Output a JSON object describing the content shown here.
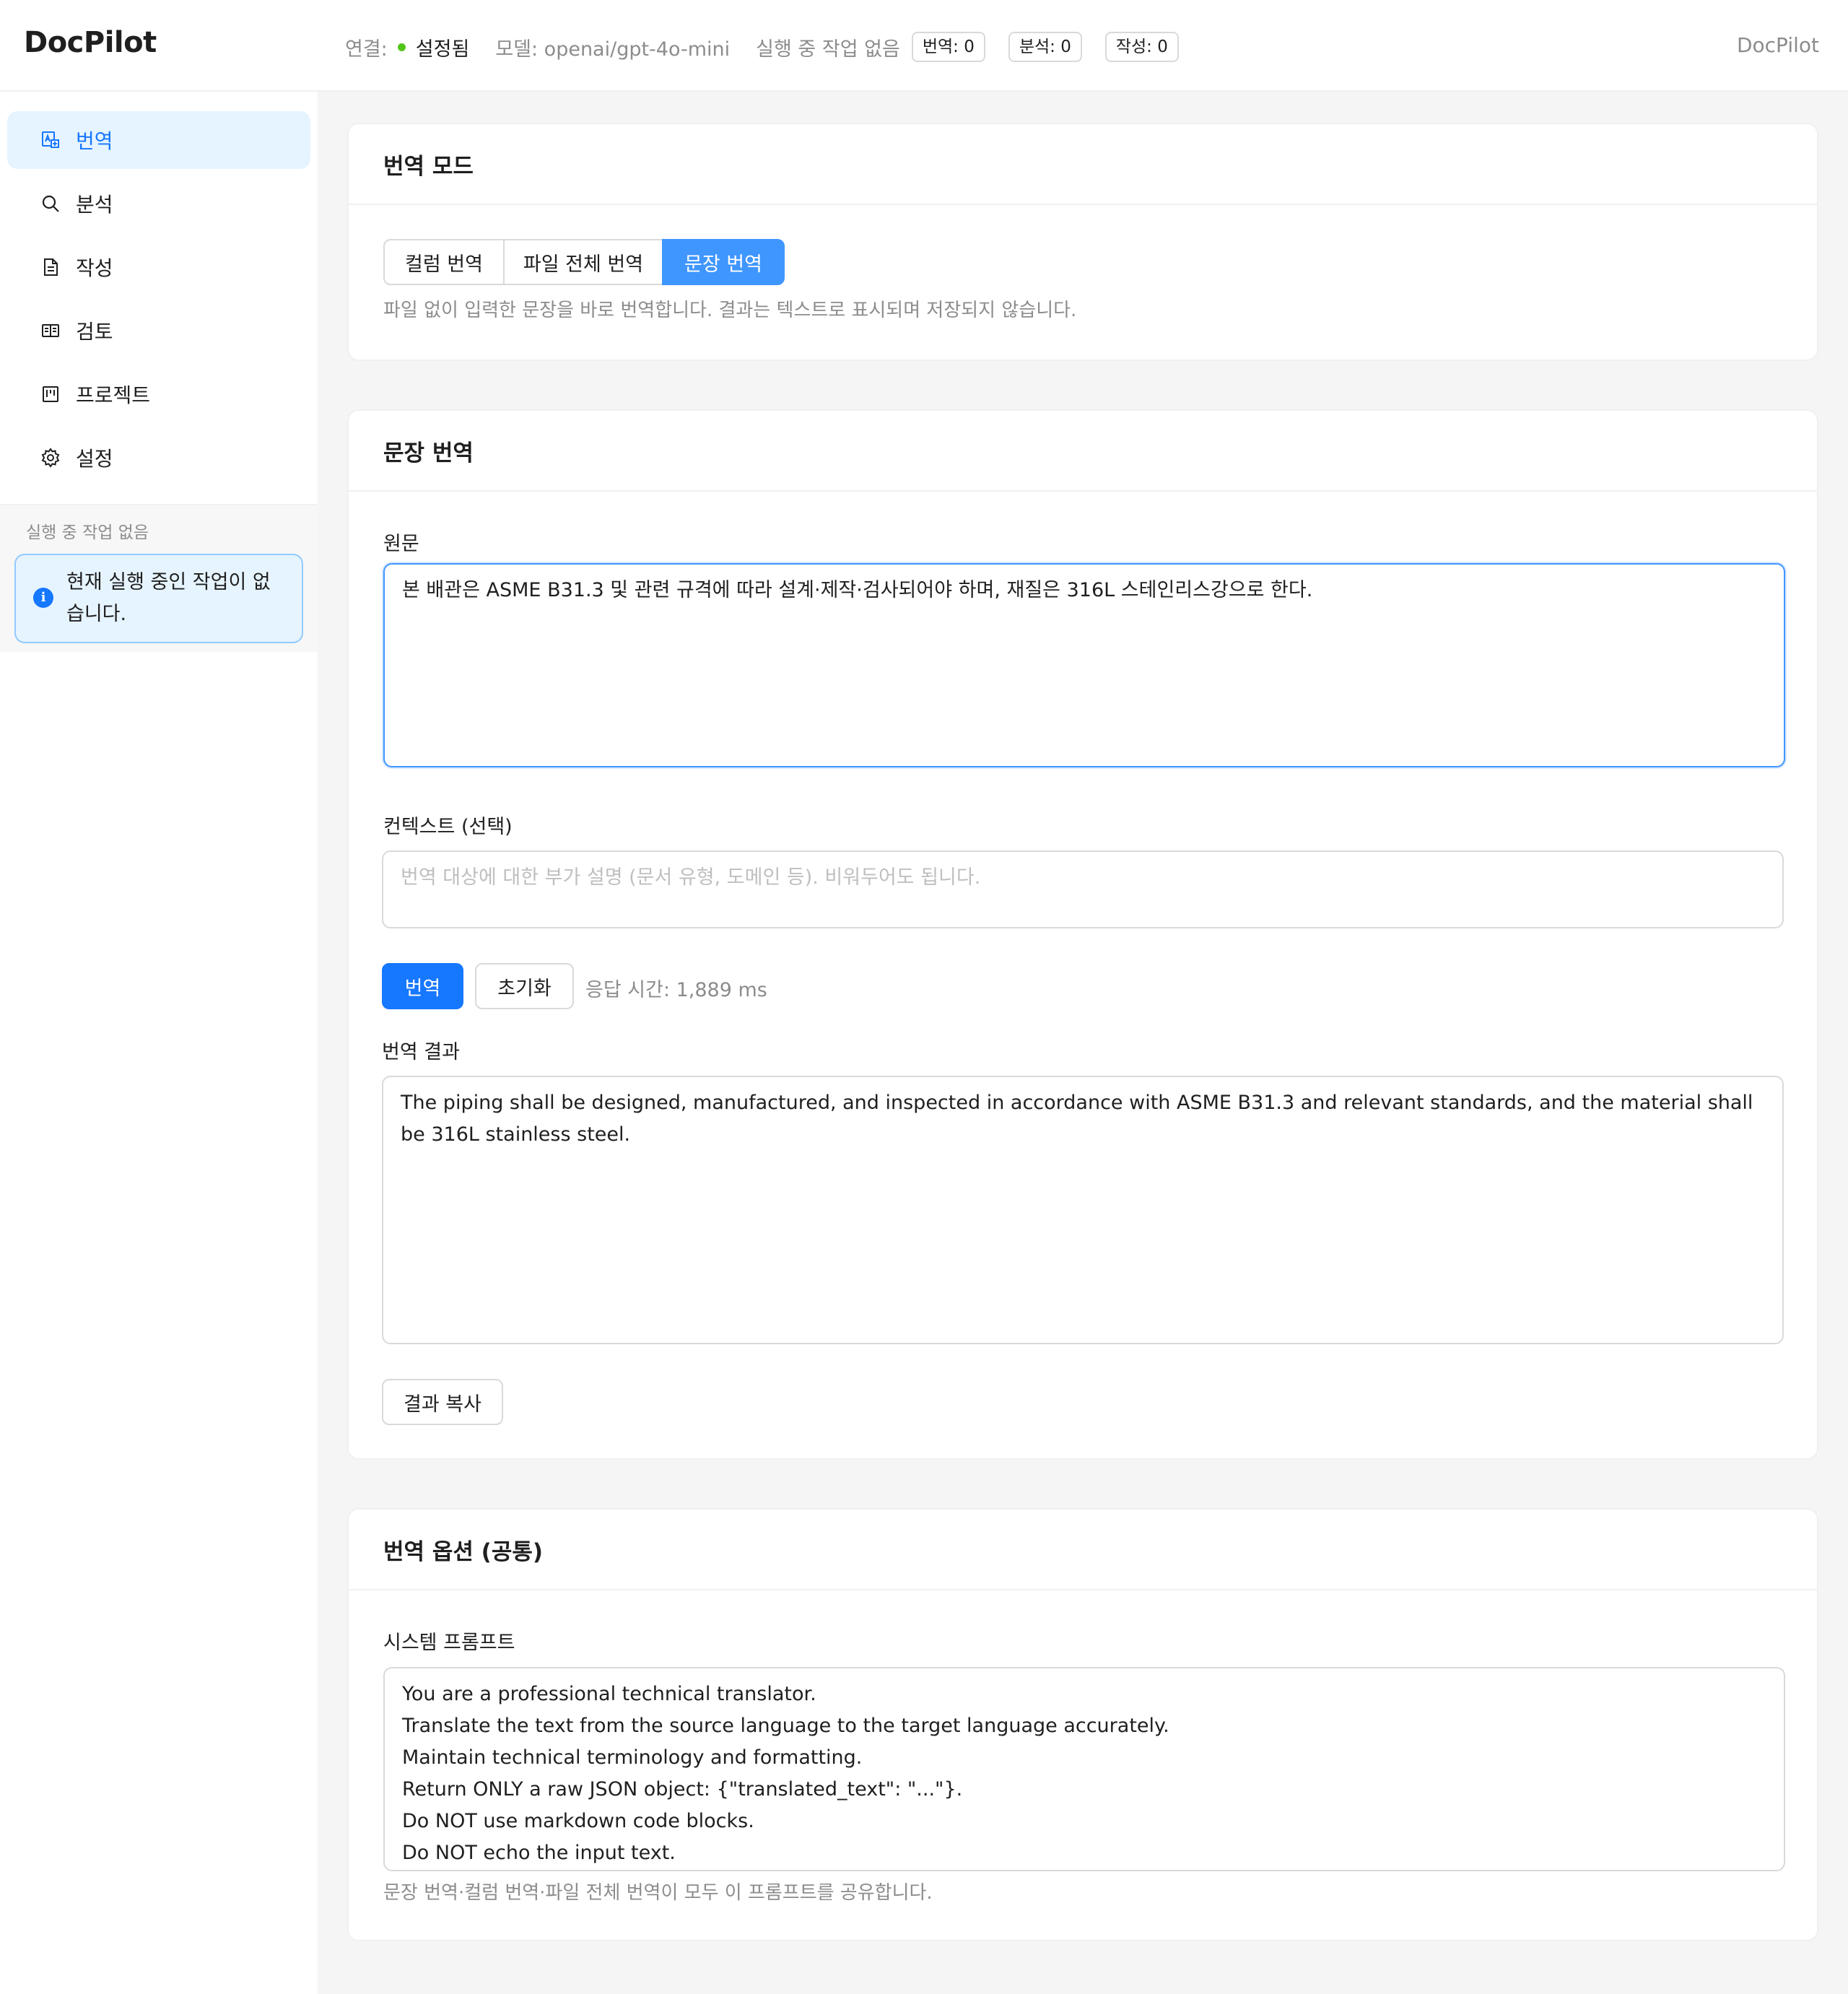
{
  "header": {
    "logo": "DocPilot",
    "conn_label": "연결:",
    "conn_value": "설정됨",
    "model": "모델: openai/gpt-4o-mini",
    "running": "실행 중 작업 없음",
    "tags": [
      "번역: 0",
      "분석: 0",
      "작성: 0"
    ],
    "right_title": "DocPilot",
    "status_color": "#52c41a"
  },
  "sidebar": {
    "items": [
      {
        "label": "번역",
        "icon": "translate-icon",
        "active": true
      },
      {
        "label": "분석",
        "icon": "search-icon",
        "active": false
      },
      {
        "label": "작성",
        "icon": "file-icon",
        "active": false
      },
      {
        "label": "검토",
        "icon": "book-icon",
        "active": false
      },
      {
        "label": "프로젝트",
        "icon": "project-icon",
        "active": false
      },
      {
        "label": "설정",
        "icon": "gear-icon",
        "active": false
      }
    ],
    "status_label": "실행 중 작업 없음",
    "alert_text": "현재 실행 중인 작업이 없습니다."
  },
  "mode_card": {
    "title": "번역 모드",
    "segments": [
      "컬럼 번역",
      "파일 전체 번역",
      "문장 번역"
    ],
    "active_segment": "문장 번역",
    "hint": "파일 없이 입력한 문장을 바로 번역합니다. 결과는 텍스트로 표시되며 저장되지 않습니다."
  },
  "sentence_card": {
    "title": "문장 번역",
    "source_label": "원문",
    "source_value": "본 배관은 ASME B31.3 및 관련 규격에 따라 설계·제작·검사되어야 하며, 재질은 316L 스테인리스강으로 한다.",
    "context_label": "컨텍스트 (선택)",
    "context_placeholder": "번역 대상에 대한 부가 설명 (문서 유형, 도메인 등). 비워두어도 됩니다.",
    "translate_button": "번역",
    "reset_button": "초기화",
    "response_time": "응답 시간: 1,889 ms",
    "result_label": "번역 결과",
    "result_value": "The piping shall be designed, manufactured, and inspected in accordance with ASME B31.3 and relevant standards, and the material shall be 316L stainless steel.",
    "copy_button": "결과 복사"
  },
  "options_card": {
    "title": "번역 옵션 (공통)",
    "prompt_label": "시스템 프롬프트",
    "prompt_value": "You are a professional technical translator.\nTranslate the text from the source language to the target language accurately.\nMaintain technical terminology and formatting.\nReturn ONLY a raw JSON object: {\"translated_text\": \"...\"}.\nDo NOT use markdown code blocks.\nDo NOT echo the input text.",
    "prompt_hint": "문장 번역·컬럼 번역·파일 전체 번역이 모두 이 프롬프트를 공유합니다."
  }
}
